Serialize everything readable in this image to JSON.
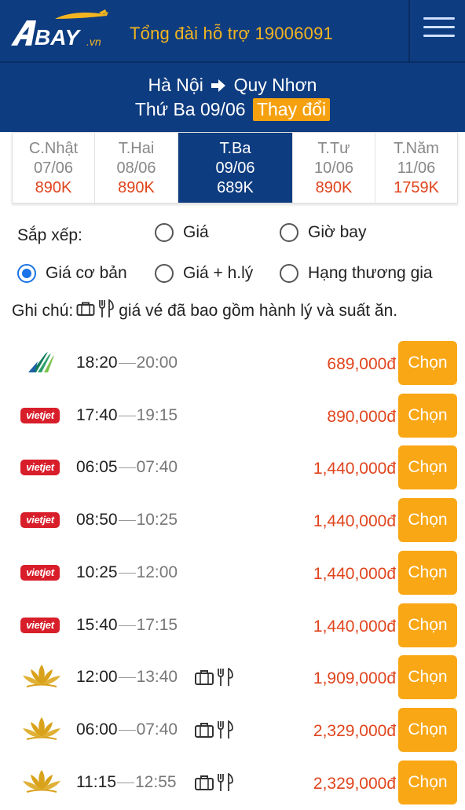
{
  "header": {
    "logo_text": "ABAY.vn",
    "hotline": "Tổng đài hỗ trợ 19006091",
    "menu_icon": "hamburger-menu-icon"
  },
  "route": {
    "from": "Hà Nội",
    "arrow_icon": "arrow-right-icon",
    "to": "Quy Nhơn",
    "date": "Thứ Ba 09/06",
    "change_label": "Thay đổi"
  },
  "date_tabs": [
    {
      "day": "C.Nhật",
      "date": "07/06",
      "price": "890K",
      "active": false
    },
    {
      "day": "T.Hai",
      "date": "08/06",
      "price": "890K",
      "active": false
    },
    {
      "day": "T.Ba",
      "date": "09/06",
      "price": "689K",
      "active": true
    },
    {
      "day": "T.Tư",
      "date": "10/06",
      "price": "890K",
      "active": false
    },
    {
      "day": "T.Năm",
      "date": "11/06",
      "price": "1759K",
      "active": false
    }
  ],
  "sort": {
    "label": "Sắp xếp:",
    "options": [
      {
        "label": "Giá",
        "selected": false
      },
      {
        "label": "Giờ bay",
        "selected": false
      },
      {
        "label": "Giá cơ bản",
        "selected": true
      },
      {
        "label": "Giá + h.lý",
        "selected": false
      },
      {
        "label": "Hạng thương gia",
        "selected": false
      }
    ]
  },
  "note": {
    "prefix": "Ghi chú:",
    "text": "giá vé đã bao gồm hành lý và suất ăn."
  },
  "choose_label": "Chọn",
  "flights": [
    {
      "airline": "bamboo",
      "airline_label": "",
      "dep": "18:20",
      "arr": "20:00",
      "price": "689,000đ",
      "bag_meal": false
    },
    {
      "airline": "vietjet",
      "airline_label": "vietjet",
      "dep": "17:40",
      "arr": "19:15",
      "price": "890,000đ",
      "bag_meal": false
    },
    {
      "airline": "vietjet",
      "airline_label": "vietjet",
      "dep": "06:05",
      "arr": "07:40",
      "price": "1,440,000đ",
      "bag_meal": false
    },
    {
      "airline": "vietjet",
      "airline_label": "vietjet",
      "dep": "08:50",
      "arr": "10:25",
      "price": "1,440,000đ",
      "bag_meal": false
    },
    {
      "airline": "vietjet",
      "airline_label": "vietjet",
      "dep": "10:25",
      "arr": "12:00",
      "price": "1,440,000đ",
      "bag_meal": false
    },
    {
      "airline": "vietjet",
      "airline_label": "vietjet",
      "dep": "15:40",
      "arr": "17:15",
      "price": "1,440,000đ",
      "bag_meal": false
    },
    {
      "airline": "vietnam-airlines",
      "airline_label": "",
      "dep": "12:00",
      "arr": "13:40",
      "price": "1,909,000đ",
      "bag_meal": true
    },
    {
      "airline": "vietnam-airlines",
      "airline_label": "",
      "dep": "06:00",
      "arr": "07:40",
      "price": "2,329,000đ",
      "bag_meal": true
    },
    {
      "airline": "vietnam-airlines",
      "airline_label": "",
      "dep": "11:15",
      "arr": "12:55",
      "price": "2,329,000đ",
      "bag_meal": true
    }
  ],
  "colors": {
    "brand_blue": "#0e3c80",
    "accent_orange": "#f9a715",
    "price_red": "#e0441d",
    "radio_blue": "#1a73e8",
    "vietjet_red": "#d81e2a",
    "vna_gold": "#d9a21b"
  }
}
